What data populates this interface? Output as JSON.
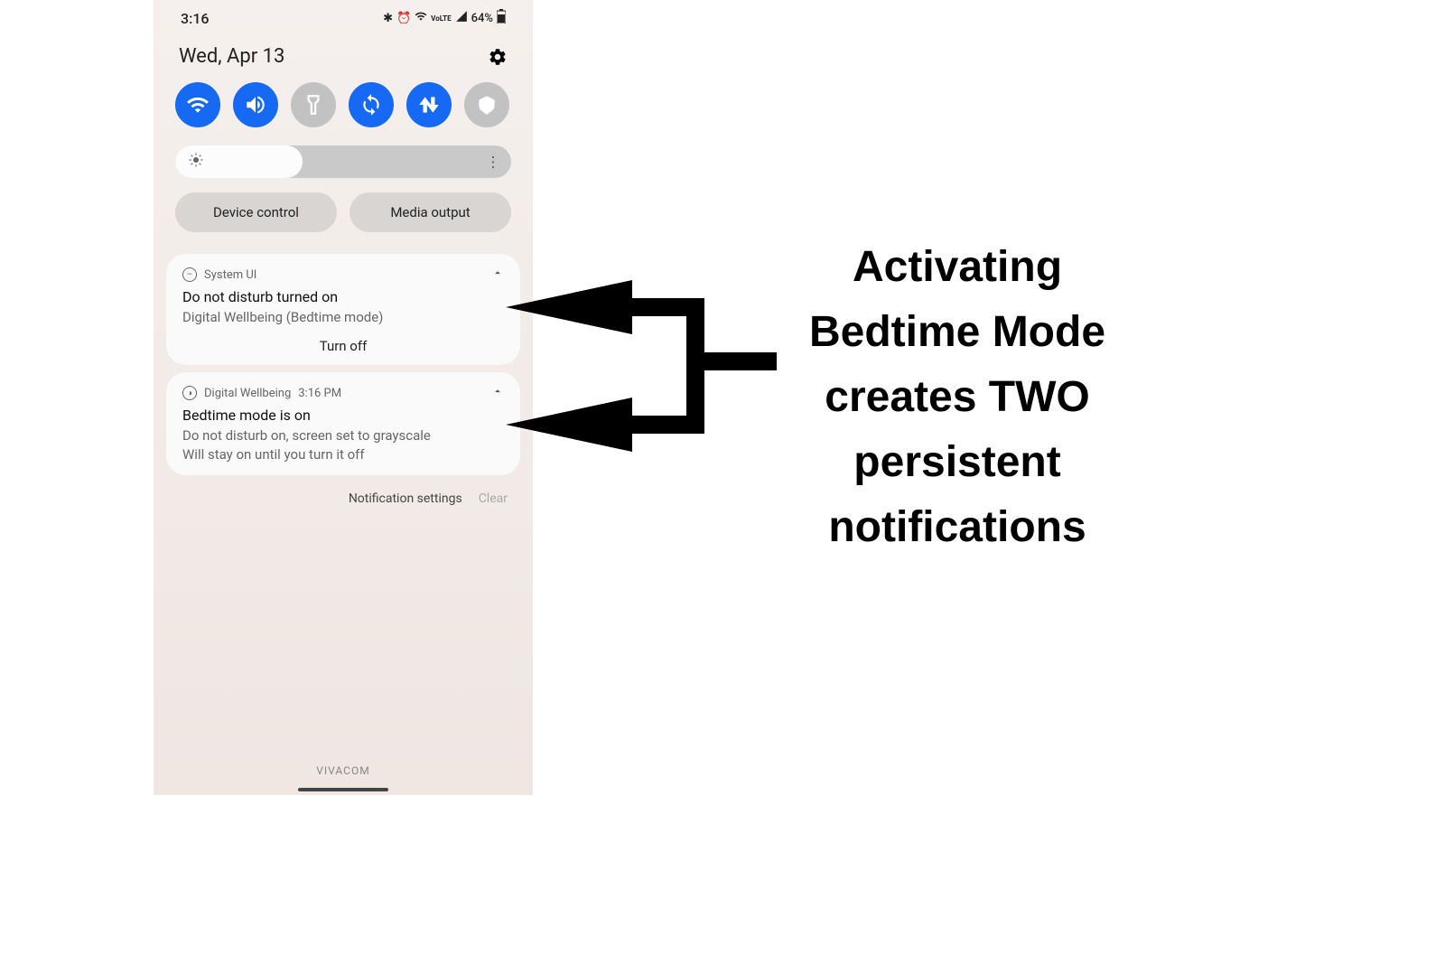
{
  "status": {
    "time": "3:16",
    "battery": "64%"
  },
  "date": "Wed, Apr 13",
  "brightness_pct": 38,
  "pills": {
    "device": "Device control",
    "media": "Media output"
  },
  "notif1": {
    "app": "System UI",
    "title": "Do not disturb turned on",
    "sub": "Digital Wellbeing (Bedtime mode)",
    "action": "Turn off"
  },
  "notif2": {
    "app": "Digital Wellbeing",
    "time": "3:16 PM",
    "title": "Bedtime mode is on",
    "line1": "Do not disturb on, screen set to grayscale",
    "line2": "Will stay on until you turn it off"
  },
  "footer": {
    "settings": "Notification settings",
    "clear": "Clear"
  },
  "carrier": "VIVACOM",
  "annotation": "Activating Bedtime Mode creates TWO persistent notifications"
}
